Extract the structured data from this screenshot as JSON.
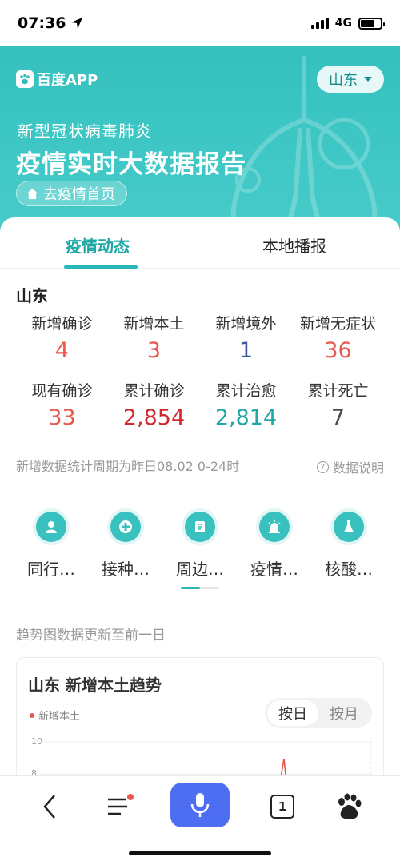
{
  "status_bar": {
    "time": "07:36",
    "network": "4G"
  },
  "header": {
    "brand": "百度APP",
    "region": "山东",
    "subtitle": "新型冠状病毒肺炎",
    "title": "疫情实时大数据报告",
    "home_link": "去疫情首页"
  },
  "tabs": [
    {
      "label": "疫情动态",
      "active": true
    },
    {
      "label": "本地播报",
      "active": false
    }
  ],
  "stats": {
    "province": "山东",
    "items": [
      {
        "label": "新增确诊",
        "value": "4",
        "color": "#e8584c"
      },
      {
        "label": "新增本土",
        "value": "3",
        "color": "#e8584c"
      },
      {
        "label": "新增境外",
        "value": "1",
        "color": "#3a5a9a"
      },
      {
        "label": "新增无症状",
        "value": "36",
        "color": "#e8584c"
      },
      {
        "label": "现有确诊",
        "value": "33",
        "color": "#e8584c"
      },
      {
        "label": "累计确诊",
        "value": "2,854",
        "color": "#d0282e"
      },
      {
        "label": "累计治愈",
        "value": "2,814",
        "color": "#1fa7a5"
      },
      {
        "label": "累计死亡",
        "value": "7",
        "color": "#4a4a4a"
      }
    ],
    "note": "新增数据统计周期为昨日08.02 0-24时",
    "explain": "数据说明"
  },
  "services": [
    {
      "label": "同行…",
      "icon": "person-icon"
    },
    {
      "label": "接种…",
      "icon": "shield-plus-icon"
    },
    {
      "label": "周边…",
      "icon": "document-icon"
    },
    {
      "label": "疫情…",
      "icon": "alarm-icon"
    },
    {
      "label": "核酸…",
      "icon": "flask-icon"
    }
  ],
  "trend_note": "趋势图数据更新至前一日",
  "chart": {
    "title": "山东 新增本土趋势",
    "legend": "新增本土",
    "toggle": [
      "按日",
      "按月"
    ],
    "toggle_selected": "按日",
    "y_ticks": [
      "10",
      "8"
    ]
  },
  "chart_data": {
    "type": "line",
    "title": "山东 新增本土趋势",
    "series": [
      {
        "name": "新增本土",
        "color": "#e8584c"
      }
    ],
    "y_ticks_visible": [
      10,
      8
    ],
    "note": "chart partially cut off; peak near right edge reaches ~8"
  },
  "bottom_nav": {
    "tab_count": "1"
  }
}
